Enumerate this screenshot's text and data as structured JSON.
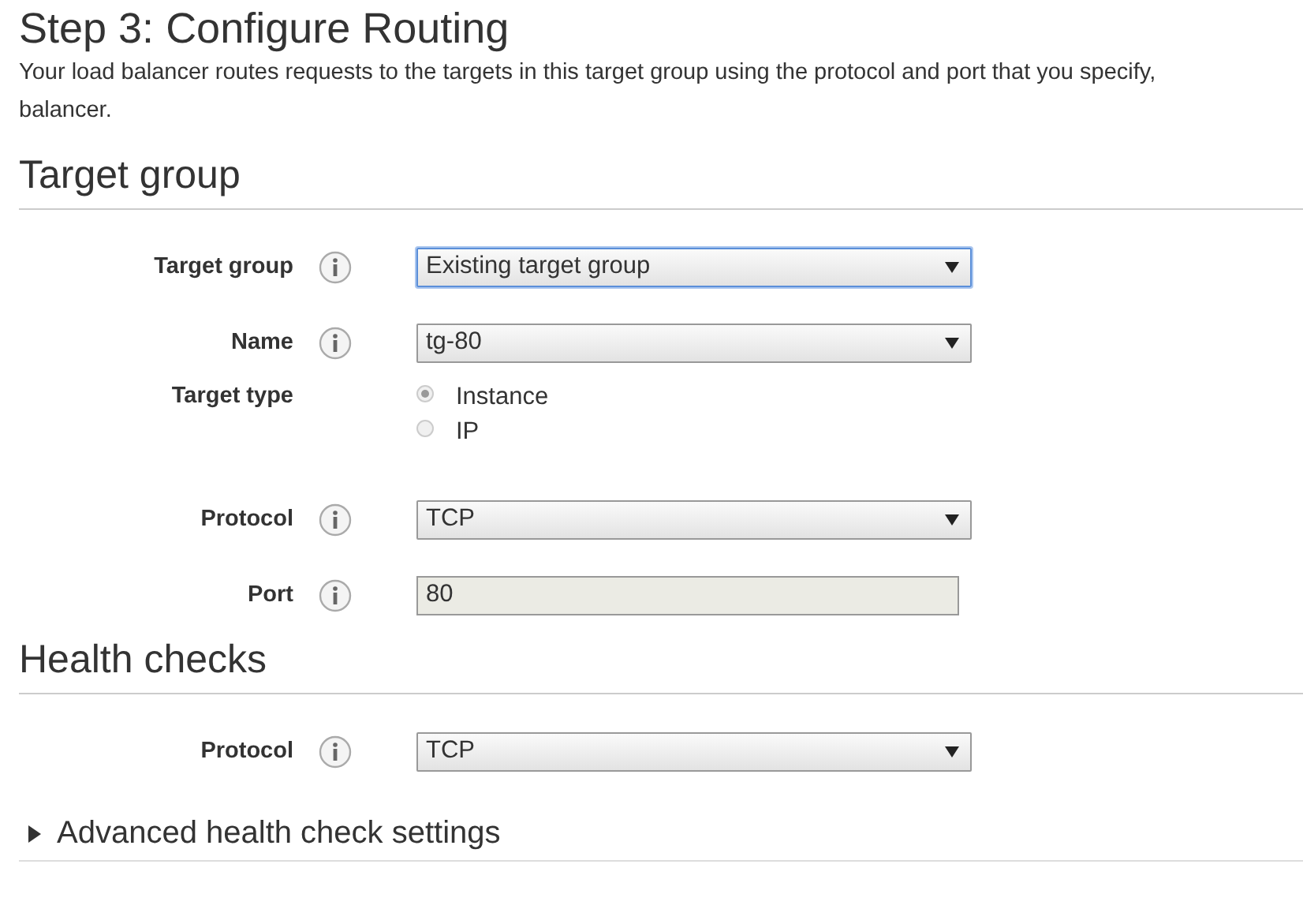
{
  "page": {
    "title": "Step 3: Configure Routing",
    "description": [
      "Your load balancer routes requests to the targets in this target group using the protocol and port that you specify,",
      "balancer."
    ]
  },
  "sections": [
    {
      "heading": "Target group",
      "fields": [
        {
          "kind": "select",
          "label": "Target group",
          "info": true,
          "value": "Existing target group",
          "focused": true
        },
        {
          "kind": "select",
          "label": "Name",
          "info": true,
          "value": "tg-80",
          "focused": false
        },
        {
          "kind": "radio",
          "label": "Target type",
          "info": false,
          "options": [
            {
              "label": "Instance",
              "selected": true
            },
            {
              "label": "IP",
              "selected": false
            }
          ]
        },
        {
          "kind": "select",
          "label": "Protocol",
          "info": true,
          "value": "TCP",
          "focused": false
        },
        {
          "kind": "text",
          "label": "Port",
          "info": true,
          "value": "80",
          "disabled": true
        }
      ]
    },
    {
      "heading": "Health checks",
      "fields": [
        {
          "kind": "select",
          "label": "Protocol",
          "info": true,
          "value": "TCP",
          "focused": false
        }
      ]
    }
  ],
  "advanced": {
    "label": "Advanced health check settings",
    "expanded": false
  }
}
